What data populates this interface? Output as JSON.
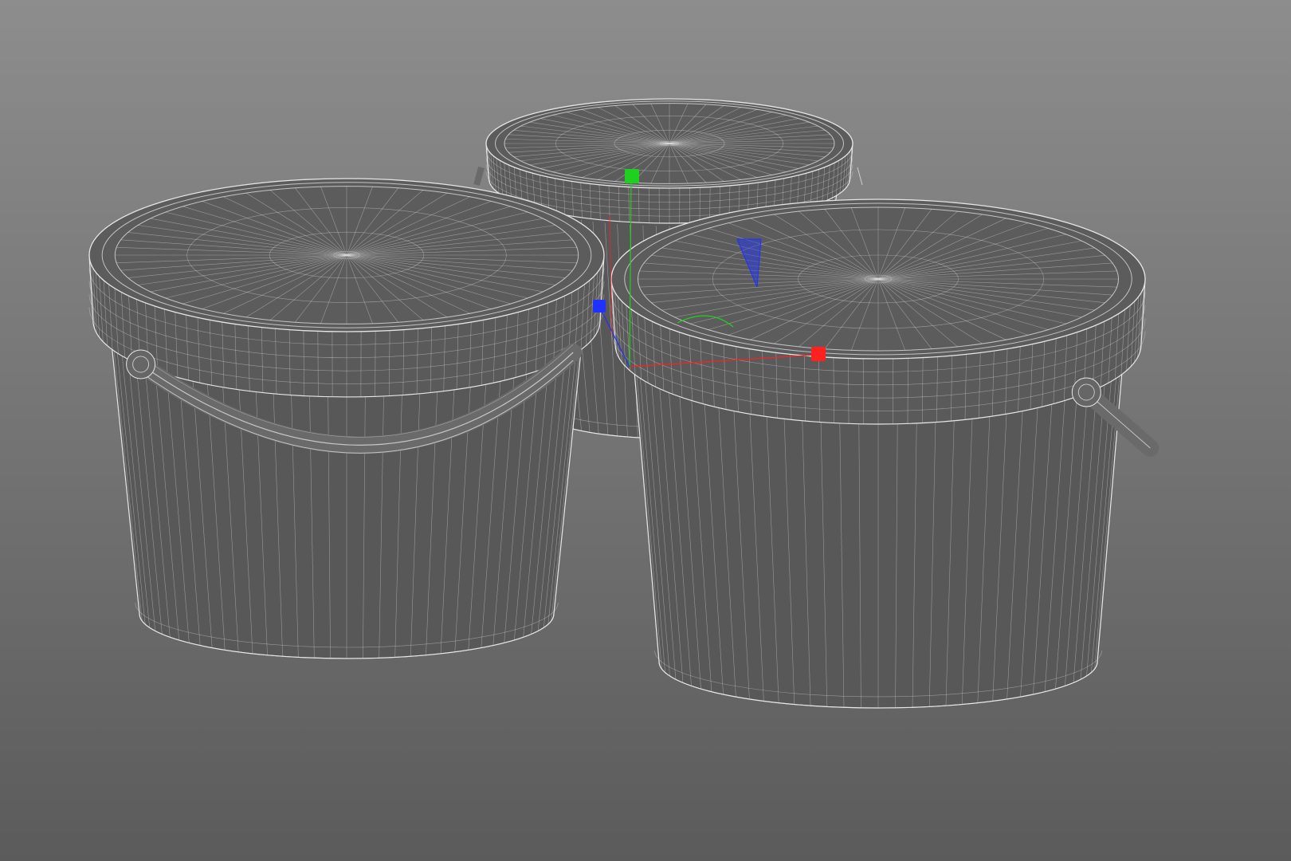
{
  "viewport": {
    "view_mode": "wireframe",
    "background_top": "#8d8d8d",
    "background_bottom": "#5b5b5b"
  },
  "scene": {
    "objects": [
      {
        "name": "bucket-back",
        "has_lid": true,
        "has_handle": true
      },
      {
        "name": "bucket-left",
        "has_lid": true,
        "has_handle": true
      },
      {
        "name": "bucket-right",
        "has_lid": true,
        "has_handle": true
      }
    ]
  },
  "colors": {
    "body_fill": "#585858",
    "wire": "#e6e6e6",
    "axis_x": "#ff2020",
    "axis_y": "#20d020",
    "axis_z": "#2030ff"
  },
  "gizmo": {
    "type": "transform-gizmo",
    "axes": [
      "x",
      "y",
      "z"
    ]
  }
}
